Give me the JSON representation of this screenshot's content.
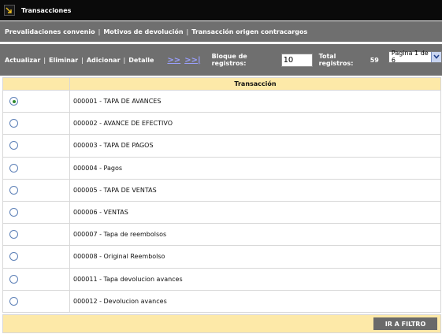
{
  "window": {
    "title": "Transacciones",
    "icon": "window-arrow-icon"
  },
  "tabs": [
    {
      "label": "Prevalidaciones convenio"
    },
    {
      "label": "Motivos de devolución"
    },
    {
      "label": "Transacción origen contracargos"
    }
  ],
  "toolbar": {
    "actions": [
      {
        "label": "Actualizar"
      },
      {
        "label": "Eliminar"
      },
      {
        "label": "Adicionar"
      },
      {
        "label": "Detalle"
      }
    ],
    "nav_next": ">>",
    "nav_last": ">>|",
    "block_label": "Bloque de registros:",
    "block_value": "10",
    "total_label": "Total registros:",
    "total_value": "59",
    "page_select": "Pagina 1 de 6"
  },
  "table": {
    "header": "Transacción",
    "rows": [
      {
        "label": "000001 - TAPA DE AVANCES",
        "selected": true
      },
      {
        "label": "000002 - AVANCE DE EFECTIVO",
        "selected": false
      },
      {
        "label": "000003 - TAPA DE PAGOS",
        "selected": false
      },
      {
        "label": "000004 - Pagos",
        "selected": false
      },
      {
        "label": "000005 - TAPA DE VENTAS",
        "selected": false
      },
      {
        "label": "000006 - VENTAS",
        "selected": false
      },
      {
        "label": "000007 - Tapa de reembolsos",
        "selected": false
      },
      {
        "label": "000008 - Original Reembolso",
        "selected": false
      },
      {
        "label": "000011 - Tapa devolucion avances",
        "selected": false
      },
      {
        "label": "000012 - Devolucion avances",
        "selected": false
      }
    ]
  },
  "footer": {
    "button_label": "IR A FILTRO"
  },
  "colors": {
    "header_bg": "#0a0a0a",
    "toolbar_bg": "#6f6f6f",
    "table_header_bg": "#fde9a8",
    "link": "#9aa0ff"
  }
}
